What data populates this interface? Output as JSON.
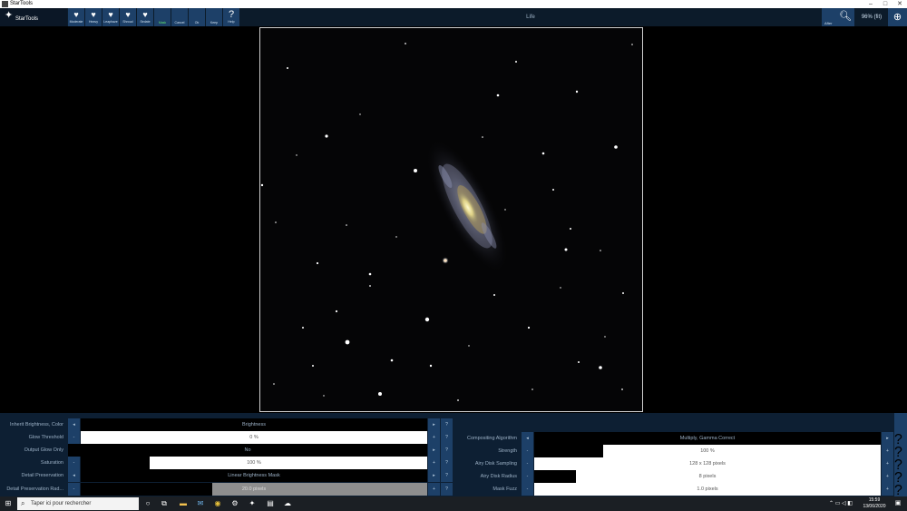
{
  "window": {
    "title": "StarTools",
    "controls": [
      "–",
      "□",
      "✕"
    ]
  },
  "toolbar": {
    "logo_text": "StarTools",
    "presets": [
      {
        "label": "Moderate",
        "icon": "heart-icon"
      },
      {
        "label": "Heavy",
        "icon": "heart-icon"
      },
      {
        "label": "Leaphaze",
        "icon": "heart-icon"
      },
      {
        "label": "Shroud",
        "icon": "heart-icon"
      },
      {
        "label": "Sedate",
        "icon": "heart-icon"
      }
    ],
    "actions": [
      {
        "label": "Mask"
      },
      {
        "label": "Cancel"
      },
      {
        "label": "Ok"
      },
      {
        "label": "Keep"
      }
    ],
    "help_label": "Help",
    "help_glyph": "?",
    "module_title": "Life",
    "after_label": "After",
    "zoom_level": "96% (fit)"
  },
  "parameters_left": [
    {
      "label": "Inherit Brightness, Color",
      "value": "Brightness",
      "style": "dark"
    },
    {
      "label": "Glow Threshold",
      "value": "0 %",
      "style": "light",
      "fill": 0
    },
    {
      "label": "Output Glow Only",
      "value": "No",
      "style": "dark"
    },
    {
      "label": "Saturation",
      "value": "100 %",
      "style": "light",
      "fill": 0.2
    },
    {
      "label": "Detail Preservation",
      "value": "Linear Brightness Mask",
      "style": "dark"
    },
    {
      "label": "Detail Preservation Rad...",
      "value": "20.0 pixels",
      "style": "grey",
      "fill": 0.38
    }
  ],
  "parameters_right": [
    {
      "label": "Compositing Algorithm",
      "value": "Multiply, Gamma Correct",
      "style": "dark"
    },
    {
      "label": "Strength",
      "value": "100 %",
      "style": "light",
      "fill": 0.2
    },
    {
      "label": "Airy Disk Sampling",
      "value": "128 x 128 pixels",
      "style": "light",
      "fill": 0
    },
    {
      "label": "Airy Disk Radius",
      "value": "8 pixels",
      "style": "light",
      "fill": 0.12
    },
    {
      "label": "Mask Fuzz",
      "value": "1.0 pixels",
      "style": "light",
      "fill": 0
    }
  ],
  "param_buttons": {
    "minus": "-",
    "plus": "+",
    "help": "?",
    "prev": "◂",
    "next": "▸"
  },
  "taskbar": {
    "search_placeholder": "Taper ici pour rechercher",
    "time": "15:59",
    "date": "13/06/2020"
  }
}
